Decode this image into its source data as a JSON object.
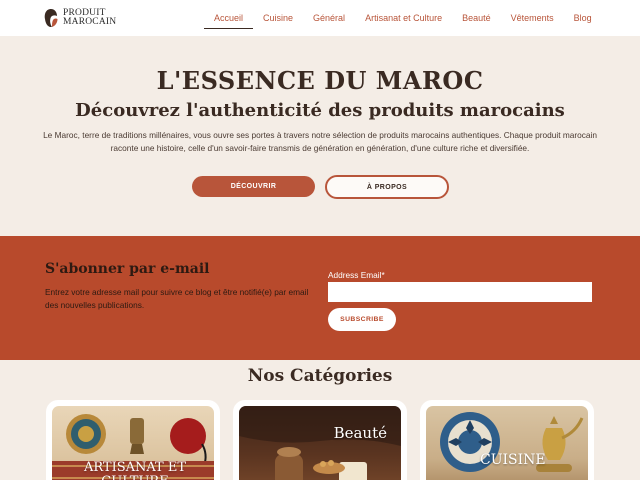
{
  "header": {
    "logo_line1": "PRODUIT",
    "logo_line2": "MAROCAIN",
    "nav": [
      {
        "label": "Accueil",
        "active": true
      },
      {
        "label": "Cuisine",
        "active": false
      },
      {
        "label": "Général",
        "active": false
      },
      {
        "label": "Artisanat et Culture",
        "active": false
      },
      {
        "label": "Beauté",
        "active": false
      },
      {
        "label": "Vêtements",
        "active": false
      },
      {
        "label": "Blog",
        "active": false
      }
    ]
  },
  "hero": {
    "title": "L'ESSENCE DU MAROC",
    "subtitle": "Découvrez l'authenticité des produits marocains",
    "description": "Le Maroc, terre de traditions millénaires, vous ouvre ses portes à travers notre sélection de produits marocains authentiques. Chaque produit marocain raconte une histoire, celle d'un savoir-faire transmis de génération en génération, d'une culture riche et diversifiée.",
    "discover_label": "DÉCOUVRIR",
    "about_label": "À PROPOS"
  },
  "subscribe": {
    "title": "S'abonner par e-mail",
    "description": "Entrez votre adresse mail pour suivre ce blog et être notifié(e) par email des nouvelles publications.",
    "email_label": "Address Email*",
    "email_value": "",
    "button_label": "SUBSCRIBE"
  },
  "categories": {
    "title": "Nos Catégories",
    "items": [
      {
        "label": "ARTISANAT ET CULTURE"
      },
      {
        "label": "Beauté"
      },
      {
        "label": "CUISINE"
      }
    ]
  },
  "colors": {
    "accent": "#b8553a",
    "band": "#b84a2c",
    "background": "#f4ede6",
    "text": "#3a2a22"
  }
}
